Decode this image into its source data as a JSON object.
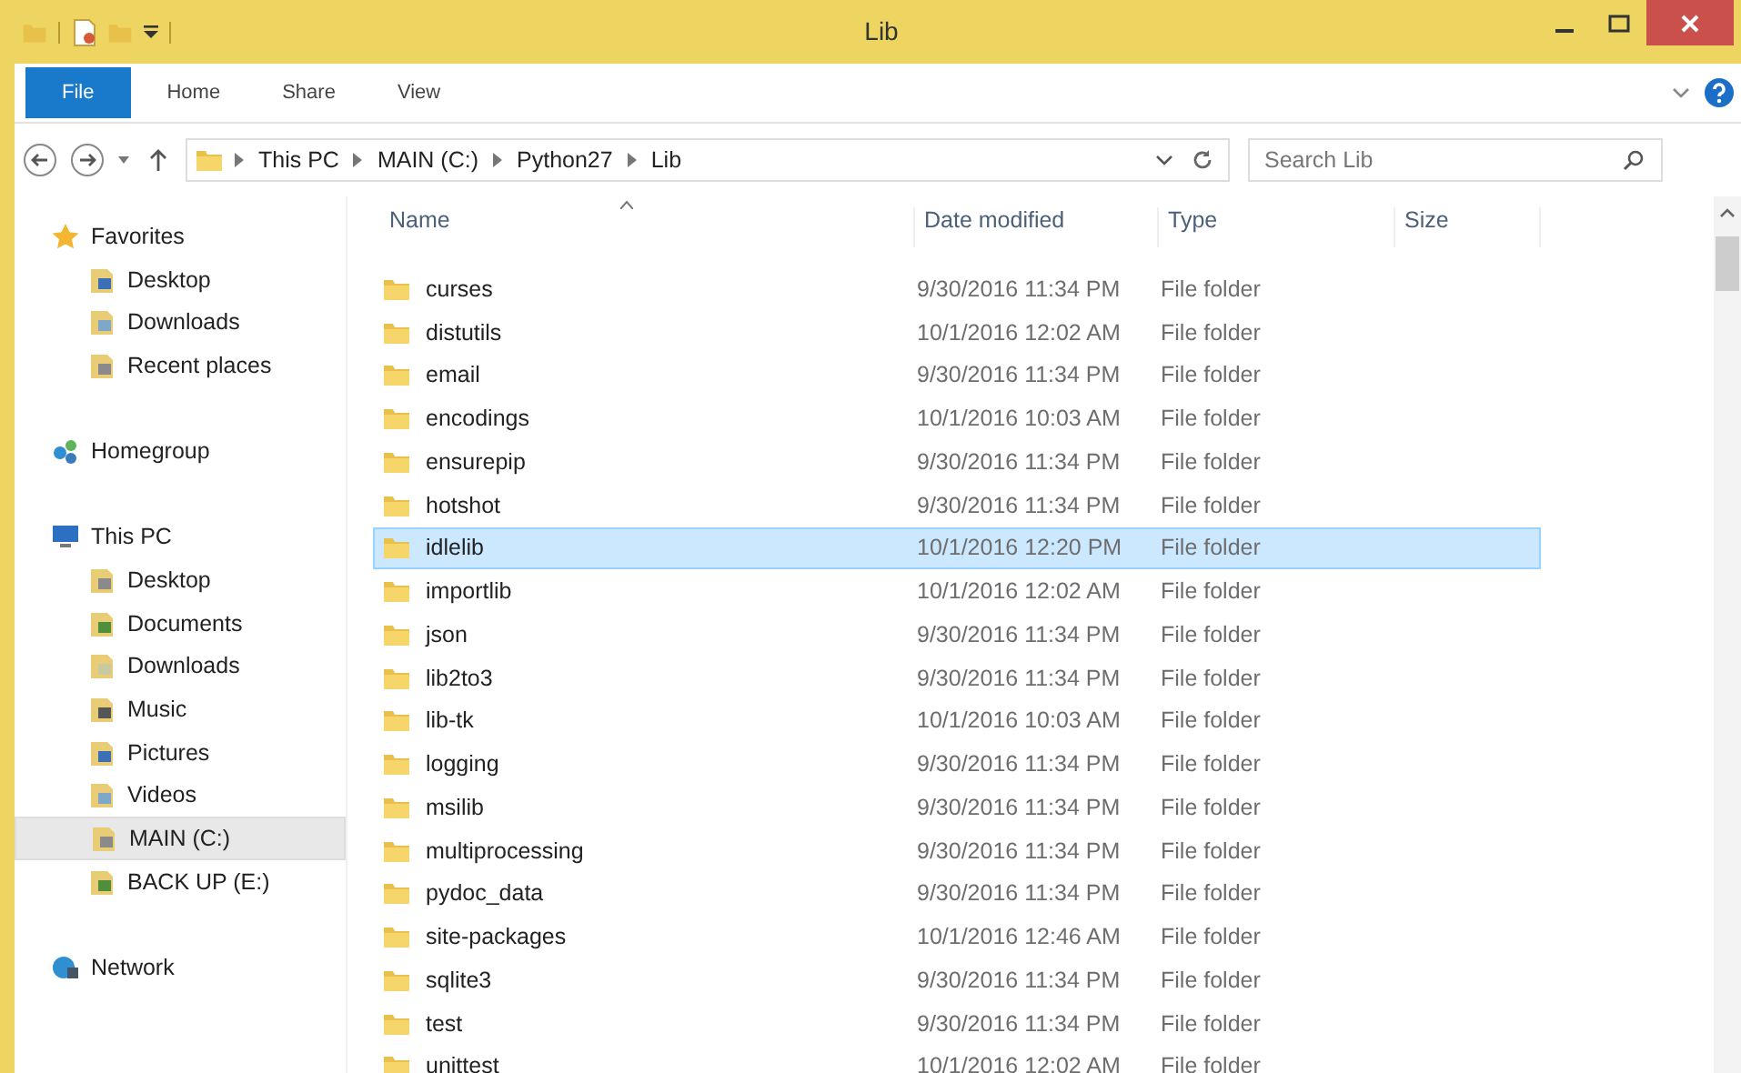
{
  "window": {
    "title": "Lib"
  },
  "ribbon": {
    "tabs": [
      {
        "label": "File",
        "selected": true
      },
      {
        "label": "Home",
        "selected": false
      },
      {
        "label": "Share",
        "selected": false
      },
      {
        "label": "View",
        "selected": false
      }
    ]
  },
  "address": {
    "path": [
      "This PC",
      "MAIN (C:)",
      "Python27",
      "Lib"
    ]
  },
  "search": {
    "placeholder": "Search Lib"
  },
  "nav": [
    {
      "label": "Favorites",
      "selected": false,
      "children": [
        {
          "label": "Desktop",
          "selected": false
        },
        {
          "label": "Downloads",
          "selected": false
        },
        {
          "label": "Recent places",
          "selected": false
        }
      ]
    },
    {
      "label": "Homegroup",
      "selected": false
    },
    {
      "label": "This PC",
      "selected": false,
      "children": [
        {
          "label": "Desktop",
          "selected": false
        },
        {
          "label": "Documents",
          "selected": false
        },
        {
          "label": "Downloads",
          "selected": false
        },
        {
          "label": "Music",
          "selected": false
        },
        {
          "label": "Pictures",
          "selected": false
        },
        {
          "label": "Videos",
          "selected": false
        },
        {
          "label": "MAIN (C:)",
          "selected": true
        },
        {
          "label": "BACK UP (E:)",
          "selected": false
        }
      ]
    },
    {
      "label": "Network",
      "selected": false
    }
  ],
  "table": {
    "columns": [
      "Name",
      "Date modified",
      "Type",
      "Size"
    ],
    "rows": [
      {
        "name": "curses",
        "date": "9/30/2016 11:34 PM",
        "type": "File folder",
        "selected": false
      },
      {
        "name": "distutils",
        "date": "10/1/2016 12:02 AM",
        "type": "File folder",
        "selected": false
      },
      {
        "name": "email",
        "date": "9/30/2016 11:34 PM",
        "type": "File folder",
        "selected": false
      },
      {
        "name": "encodings",
        "date": "10/1/2016 10:03 AM",
        "type": "File folder",
        "selected": false
      },
      {
        "name": "ensurepip",
        "date": "9/30/2016 11:34 PM",
        "type": "File folder",
        "selected": false
      },
      {
        "name": "hotshot",
        "date": "9/30/2016 11:34 PM",
        "type": "File folder",
        "selected": false
      },
      {
        "name": "idlelib",
        "date": "10/1/2016 12:20 PM",
        "type": "File folder",
        "selected": true
      },
      {
        "name": "importlib",
        "date": "10/1/2016 12:02 AM",
        "type": "File folder",
        "selected": false
      },
      {
        "name": "json",
        "date": "9/30/2016 11:34 PM",
        "type": "File folder",
        "selected": false
      },
      {
        "name": "lib2to3",
        "date": "9/30/2016 11:34 PM",
        "type": "File folder",
        "selected": false
      },
      {
        "name": "lib-tk",
        "date": "10/1/2016 10:03 AM",
        "type": "File folder",
        "selected": false
      },
      {
        "name": "logging",
        "date": "9/30/2016 11:34 PM",
        "type": "File folder",
        "selected": false
      },
      {
        "name": "msilib",
        "date": "9/30/2016 11:34 PM",
        "type": "File folder",
        "selected": false
      },
      {
        "name": "multiprocessing",
        "date": "9/30/2016 11:34 PM",
        "type": "File folder",
        "selected": false
      },
      {
        "name": "pydoc_data",
        "date": "9/30/2016 11:34 PM",
        "type": "File folder",
        "selected": false
      },
      {
        "name": "site-packages",
        "date": "10/1/2016 12:46 AM",
        "type": "File folder",
        "selected": false
      },
      {
        "name": "sqlite3",
        "date": "9/30/2016 11:34 PM",
        "type": "File folder",
        "selected": false
      },
      {
        "name": "test",
        "date": "9/30/2016 11:34 PM",
        "type": "File folder",
        "selected": false
      },
      {
        "name": "unittest",
        "date": "10/1/2016 12:02 AM",
        "type": "File folder",
        "selected": false
      }
    ]
  }
}
